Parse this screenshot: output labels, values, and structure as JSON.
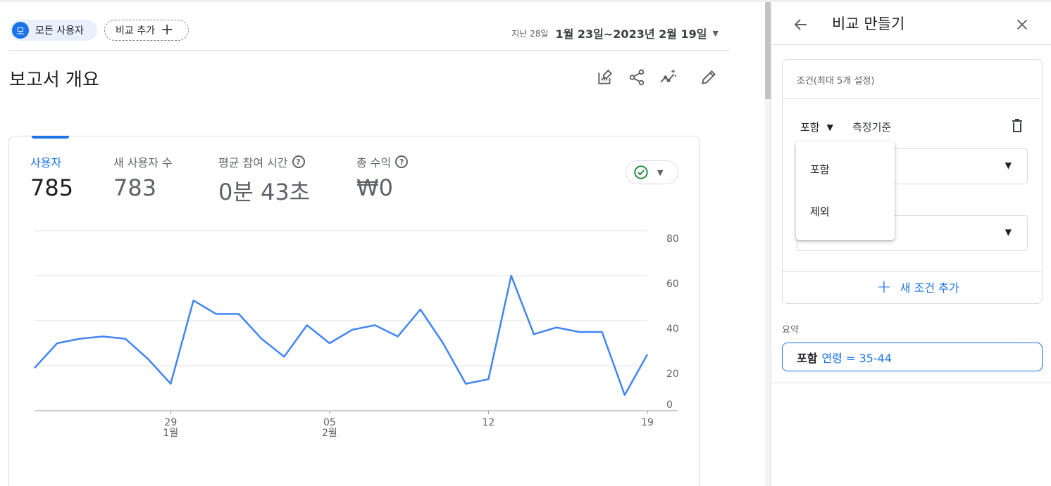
{
  "filter_bar": {
    "all_users_avatar": "모",
    "all_users_label": "모든 사용자",
    "add_comparison_label": "비교 추가",
    "add_icon": "+",
    "date_period": "지난 28일",
    "date_range": "1월 23일~2023년 2월 19일"
  },
  "page": {
    "title": "보고서 개요"
  },
  "toolbar_icons": [
    "edit-report-icon",
    "share-icon",
    "insights-icon",
    "pencil-icon"
  ],
  "metrics": [
    {
      "label": "사용자",
      "value": "785",
      "help": false
    },
    {
      "label": "새 사용자 수",
      "value": "783",
      "help": false
    },
    {
      "label": "평균 참여 시간",
      "value": "0분 43초",
      "help": true
    },
    {
      "label": "총 수익",
      "value": "₩0",
      "help": true
    }
  ],
  "help_glyph": "?",
  "colors": {
    "accent": "#1a73e8",
    "line": "#4285f4",
    "status_ok": "#188038"
  },
  "chart_data": {
    "type": "line",
    "series": [
      {
        "values": [
          19,
          30,
          32,
          33,
          32,
          23,
          12,
          49,
          43,
          43,
          32,
          24,
          38,
          30,
          36,
          38,
          33,
          45,
          30,
          12,
          14,
          60,
          34,
          37,
          35,
          35,
          7,
          25
        ]
      }
    ],
    "x": [
      "1월 23일",
      "1월 24일",
      "1월 25일",
      "1월 26일",
      "1월 27일",
      "1월 28일",
      "1월 29일",
      "1월 30일",
      "1월 31일",
      "2월 1일",
      "2월 2일",
      "2월 3일",
      "2월 4일",
      "2월 5일",
      "2월 6일",
      "2월 7일",
      "2월 8일",
      "2월 9일",
      "2월 10일",
      "2월 11일",
      "2월 12일",
      "2월 13일",
      "2월 14일",
      "2월 15일",
      "2월 16일",
      "2월 17일",
      "2월 18일",
      "2월 19일"
    ],
    "x_ticks": [
      {
        "index": 6,
        "day": "29",
        "month": "1월"
      },
      {
        "index": 13,
        "day": "05",
        "month": "2월"
      },
      {
        "index": 20,
        "day": "12",
        "month": ""
      },
      {
        "index": 27,
        "day": "19",
        "month": ""
      }
    ],
    "y_ticks": [
      0,
      20,
      40,
      60,
      80
    ],
    "ylim": [
      0,
      80
    ],
    "grid": true,
    "y_axis_side": "right"
  },
  "panel": {
    "title": "비교 만들기",
    "conditions_title": "조건(최대 5개 설정)",
    "include_value": "포함",
    "dimension_placeholder": "측정기준",
    "add_condition_label": "새 조건 추가",
    "summary_label": "요약",
    "summary_keyword": "포함",
    "summary_expression": "연령 = 35-44"
  },
  "include_menu": {
    "options": [
      "포함",
      "제외"
    ]
  }
}
